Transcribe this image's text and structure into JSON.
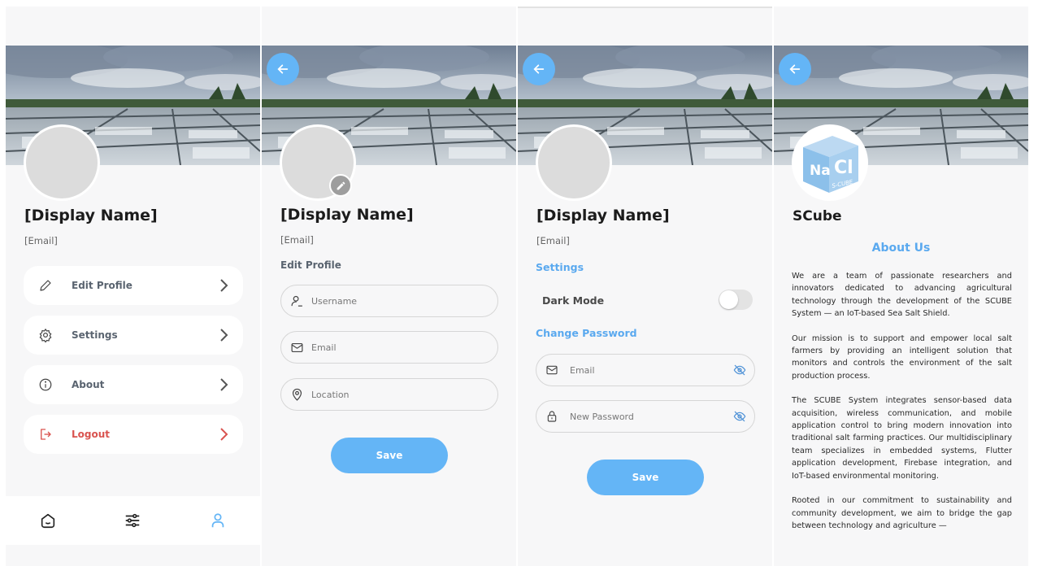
{
  "colors": {
    "accent": "#64b5f6",
    "logout": "#d9534f",
    "text_muted": "#5a6470",
    "screen_bg": "#f7f7f8"
  },
  "profile": {
    "display_name": "[Display Name]",
    "email": "[Email]",
    "menu": [
      {
        "label": "Edit Profile",
        "icon": "pencil-icon"
      },
      {
        "label": "Settings",
        "icon": "gear-icon"
      },
      {
        "label": "About",
        "icon": "info-icon"
      },
      {
        "label": "Logout",
        "icon": "logout-icon"
      }
    ],
    "nav": [
      "home-icon",
      "sliders-icon",
      "user-icon"
    ]
  },
  "edit_profile": {
    "display_name": "[Display Name]",
    "email": "[Email]",
    "section_title": "Edit Profile",
    "username_placeholder": "Username",
    "email_placeholder": "Email",
    "location_placeholder": "Location",
    "save_label": "Save"
  },
  "settings": {
    "display_name": "[Display Name]",
    "email": "[Email]",
    "section_title": "Settings",
    "dark_mode_label": "Dark Mode",
    "dark_mode_on": false,
    "change_password_title": "Change Password",
    "email_placeholder": "Email",
    "new_password_placeholder": "New Password",
    "save_label": "Save"
  },
  "about": {
    "app_name": "SCube",
    "logo_text_main": "NaCl",
    "logo_text_sub": "S-CUBE",
    "title": "About Us",
    "paragraphs": [
      "We are a team of passionate researchers and innovators dedicated to advancing agricultural technology through the development of the SCUBE System — an IoT-based Sea Salt Shield.",
      "Our mission is to support and empower local salt farmers by providing an intelligent solution that monitors and controls the environment of the salt production process.",
      "The SCUBE System integrates sensor-based data acquisition, wireless communication, and mobile application control to bring modern innovation into traditional salt farming practices. Our multidisciplinary team specializes in embedded systems, Flutter application development, Firebase integration, and IoT-based environmental monitoring.",
      "Rooted in our commitment to sustainability and community development, we aim to bridge the gap between technology and agriculture —"
    ]
  }
}
